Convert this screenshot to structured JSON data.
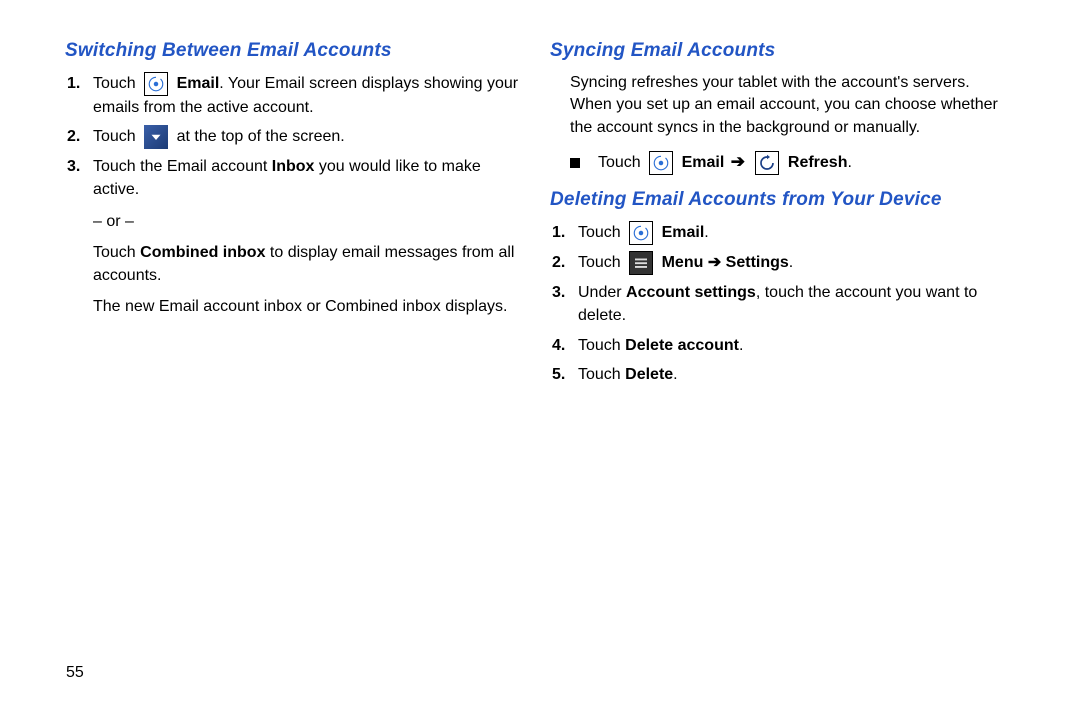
{
  "pageNumber": "55",
  "left": {
    "heading": "Switching Between Email Accounts",
    "step1_a": "Touch ",
    "step1_bold": "Email",
    "step1_b": ". Your Email screen displays showing your emails from the active account.",
    "step2_a": "Touch ",
    "step2_b": " at the top of the screen.",
    "step3_a": "Touch the Email account ",
    "step3_bold": "Inbox",
    "step3_b": " you would like to make active.",
    "or_text": "– or –",
    "combined_a": "Touch ",
    "combined_bold": "Combined inbox",
    "combined_b": " to display email messages from all accounts.",
    "result": "The new Email account inbox or Combined inbox displays."
  },
  "rightA": {
    "heading": "Syncing Email Accounts",
    "intro": "Syncing refreshes your tablet with the account's servers. When you set up an email account, you can choose whether the account syncs in the background or manually.",
    "bullet_a": "Touch ",
    "bullet_email": "Email",
    "bullet_arrow": "➔",
    "bullet_refresh": "Refresh",
    "bullet_end": "."
  },
  "rightB": {
    "heading": "Deleting Email Accounts from Your Device",
    "d1_a": "Touch ",
    "d1_bold": "Email",
    "d1_end": ".",
    "d2_a": "Touch ",
    "d2_menu": "Menu",
    "d2_arrow": " ➔ ",
    "d2_settings": "Settings",
    "d2_end": ".",
    "d3_a": "Under ",
    "d3_bold": "Account settings",
    "d3_b": ", touch the account you want to delete.",
    "d4_a": "Touch ",
    "d4_bold": "Delete account",
    "d4_end": ".",
    "d5_a": "Touch ",
    "d5_bold": "Delete",
    "d5_end": "."
  }
}
